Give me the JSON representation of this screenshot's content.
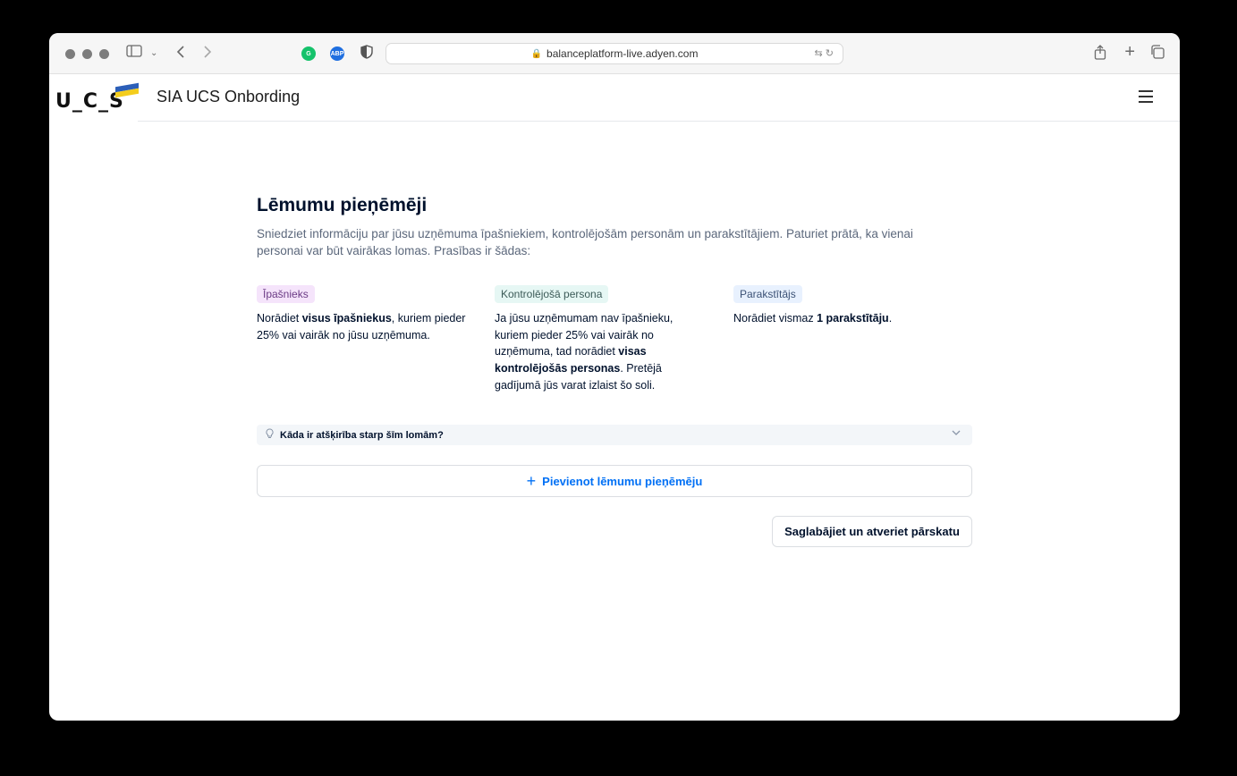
{
  "browser": {
    "url": "balanceplatform-live.adyen.com"
  },
  "app": {
    "logo_text": "U_C_S",
    "title": "SIA UCS Onbording"
  },
  "main": {
    "title": "Lēmumu pieņēmēji",
    "description": "Sniedziet informāciju par jūsu uzņēmuma īpašniekiem, kontrolējošām personām un parakstītājiem. Paturiet prātā, ka vienai personai var būt vairākas lomas. Prasības ir šādas:",
    "roles": [
      {
        "tag": "Īpašnieks",
        "text_before": "Norādiet ",
        "text_bold": "visus īpašniekus",
        "text_after": ", kuriem pieder 25% vai vairāk no jūsu uzņēmuma."
      },
      {
        "tag": "Kontrolējošā persona",
        "text_before": "Ja jūsu uzņēmumam nav īpašnieku, kuriem pieder 25% vai vairāk no uzņēmuma, tad norādiet ",
        "text_bold": "visas kontrolējošās personas",
        "text_after": ". Pretējā gadījumā jūs varat izlaist šo soli."
      },
      {
        "tag": "Parakstītājs",
        "text_before": "Norādiet vismaz ",
        "text_bold": "1 parakstītāju",
        "text_after": "."
      }
    ],
    "accordion_label": "Kāda ir atšķirība starp šīm lomām?",
    "add_button": "Pievienot lēmumu pieņēmēju",
    "save_button": "Saglabājiet un atveriet pārskatu"
  },
  "colors": {
    "accent": "#0070f5",
    "text": "#00112c"
  }
}
